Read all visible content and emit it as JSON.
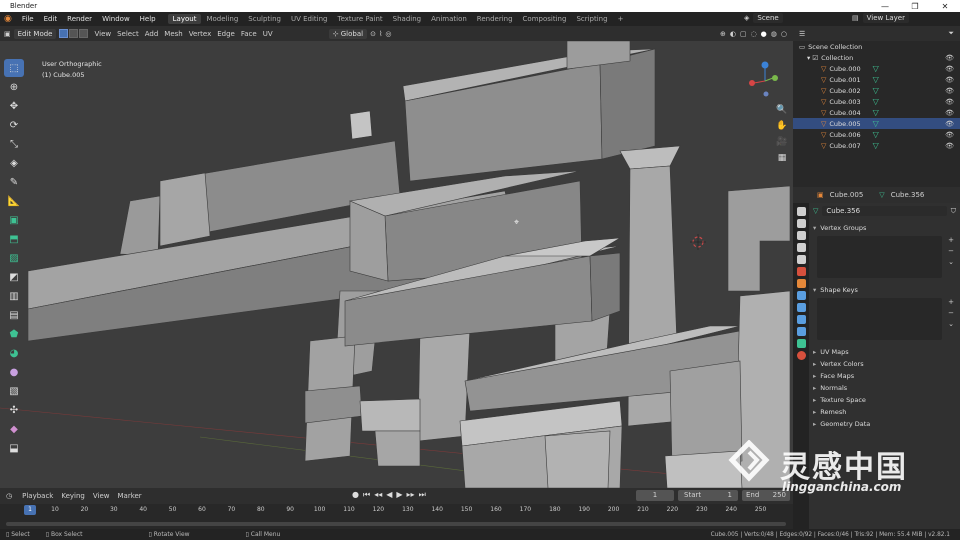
{
  "window": {
    "title": "Blender",
    "minimize": "—",
    "maximize": "❐",
    "close": "✕"
  },
  "menu": [
    "File",
    "Edit",
    "Render",
    "Window",
    "Help"
  ],
  "workspaces": [
    "Layout",
    "Modeling",
    "Sculpting",
    "UV Editing",
    "Texture Paint",
    "Shading",
    "Animation",
    "Rendering",
    "Compositing",
    "Scripting",
    "+"
  ],
  "active_workspace": "Layout",
  "scene": "Scene",
  "view_layer": "View Layer",
  "viewport_header": {
    "mode": "Edit Mode",
    "menus": [
      "View",
      "Select",
      "Add",
      "Mesh",
      "Vertex",
      "Edge",
      "Face",
      "UV"
    ],
    "orientation": "Global",
    "options": "Options",
    "axes": [
      "X",
      "Y",
      "Z"
    ]
  },
  "viewport": {
    "view_name": "User Orthographic",
    "object": "(1) Cube.005"
  },
  "outliner": {
    "root": "Scene Collection",
    "collection": "Collection",
    "items": [
      {
        "name": "Cube.000",
        "selected": false
      },
      {
        "name": "Cube.001",
        "selected": false
      },
      {
        "name": "Cube.002",
        "selected": false
      },
      {
        "name": "Cube.003",
        "selected": false
      },
      {
        "name": "Cube.004",
        "selected": false
      },
      {
        "name": "Cube.005",
        "selected": true
      },
      {
        "name": "Cube.006",
        "selected": false
      },
      {
        "name": "Cube.007",
        "selected": false
      }
    ]
  },
  "properties": {
    "object": "Cube.005",
    "mesh": "Cube.356",
    "mesh_field": "Cube.356",
    "panels": [
      {
        "label": "Vertex Groups",
        "open": true
      },
      {
        "label": "Shape Keys",
        "open": true
      },
      {
        "label": "UV Maps",
        "open": false
      },
      {
        "label": "Vertex Colors",
        "open": false
      },
      {
        "label": "Face Maps",
        "open": false
      },
      {
        "label": "Normals",
        "open": false
      },
      {
        "label": "Texture Space",
        "open": false
      },
      {
        "label": "Remesh",
        "open": false
      },
      {
        "label": "Geometry Data",
        "open": false
      }
    ],
    "tab_colors": [
      "#d0d0d0",
      "#d0d0d0",
      "#d0d0d0",
      "#d0d0d0",
      "#d0d0d0",
      "#d6503d",
      "#e5883a",
      "#5a9ee0",
      "#5a9ee0",
      "#5a9ee0",
      "#5a9ee0",
      "#3ec293",
      "#d6503d"
    ]
  },
  "timeline": {
    "menus": [
      "Playback",
      "Keying",
      "View",
      "Marker"
    ],
    "current_frame": "1",
    "start_label": "Start",
    "start": "1",
    "end_label": "End",
    "end": "250",
    "ticks": [
      "10",
      "20",
      "30",
      "40",
      "50",
      "60",
      "70",
      "80",
      "90",
      "100",
      "110",
      "120",
      "130",
      "140",
      "150",
      "160",
      "170",
      "180",
      "190",
      "200",
      "210",
      "220",
      "230",
      "240",
      "250"
    ],
    "playhead": "1"
  },
  "statusbar": {
    "select": "Select",
    "box_select": "Box Select",
    "rotate": "Rotate View",
    "call_menu": "Call Menu",
    "stats": "Cube.005 | Verts:0/48 | Edges:0/92 | Faces:0/46 | Tris:92 | Mem: 55.4 MiB | v2.82.1"
  },
  "watermark": {
    "cn": "灵感中国",
    "en": "lingganchina.com"
  },
  "colors": {
    "accent": "#4772b3",
    "selected_row": "#334d80",
    "mesh_icon": "#3ec293",
    "object_icon": "#e5883a"
  }
}
